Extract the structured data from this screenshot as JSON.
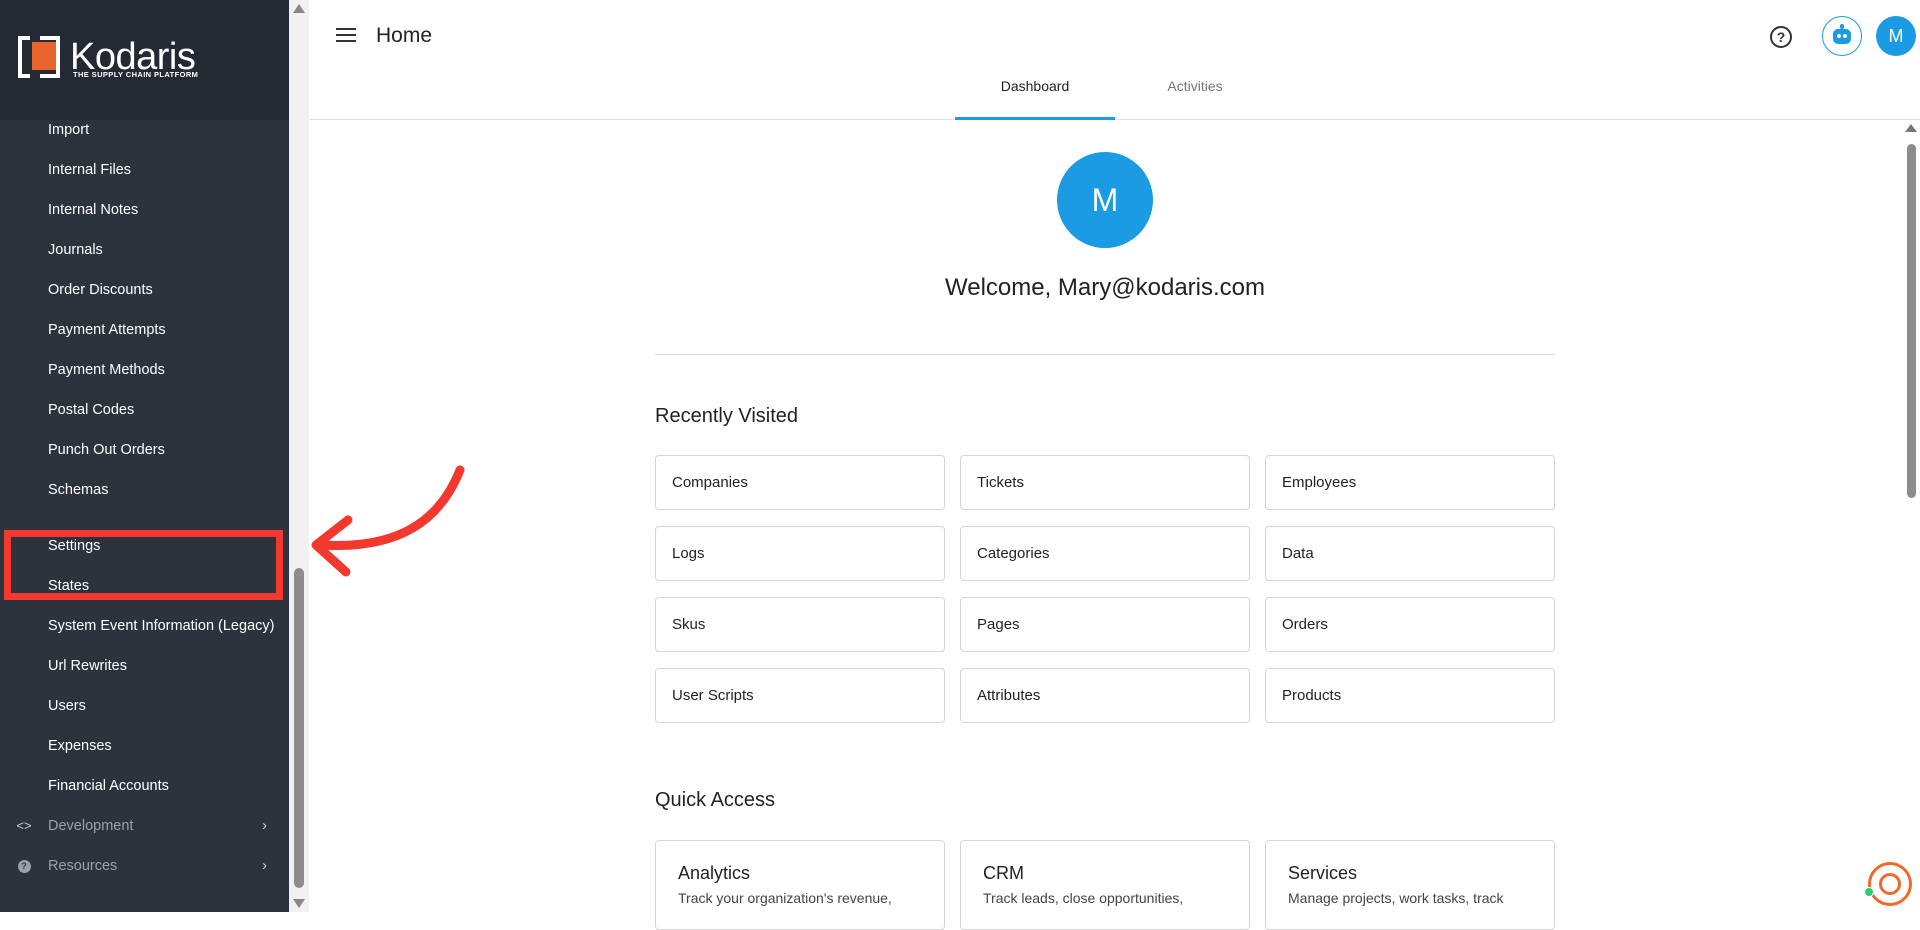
{
  "brand": {
    "name": "Kodaris",
    "tagline": "THE SUPPLY CHAIN PLATFORM",
    "accent": "#1a9be3",
    "sidebar_bg": "#2c333d",
    "highlight": "#f2382f"
  },
  "sidebar": {
    "items": [
      {
        "label": "Import"
      },
      {
        "label": "Internal Files"
      },
      {
        "label": "Internal Notes"
      },
      {
        "label": "Journals"
      },
      {
        "label": "Order Discounts"
      },
      {
        "label": "Payment Attempts"
      },
      {
        "label": "Payment Methods"
      },
      {
        "label": "Postal Codes"
      },
      {
        "label": "Punch Out Orders"
      },
      {
        "label": "Schemas"
      },
      {
        "label": "Settings",
        "highlighted": true
      },
      {
        "label": "States"
      },
      {
        "label": "System Event Information (Legacy)"
      },
      {
        "label": "Url Rewrites"
      },
      {
        "label": "Users"
      },
      {
        "label": "Expenses"
      },
      {
        "label": "Financial Accounts"
      }
    ],
    "sections": [
      {
        "label": "Development",
        "icon": "code-icon"
      },
      {
        "label": "Resources",
        "icon": "help-icon"
      }
    ]
  },
  "header": {
    "title": "Home",
    "avatar_initial": "M",
    "tabs": [
      {
        "label": "Dashboard",
        "active": true
      },
      {
        "label": "Activities",
        "active": false
      }
    ]
  },
  "main": {
    "avatar_initial": "M",
    "welcome": "Welcome, Mary@kodaris.com",
    "recently_visited": {
      "title": "Recently Visited",
      "items": [
        "Companies",
        "Tickets",
        "Employees",
        "Logs",
        "Categories",
        "Data",
        "Skus",
        "Pages",
        "Orders",
        "User Scripts",
        "Attributes",
        "Products"
      ]
    },
    "quick_access": {
      "title": "Quick Access",
      "cards": [
        {
          "title": "Analytics",
          "desc": "Track your organization's revenue,"
        },
        {
          "title": "CRM",
          "desc": "Track leads, close opportunities,"
        },
        {
          "title": "Services",
          "desc": "Manage projects, work tasks, track"
        }
      ]
    }
  }
}
